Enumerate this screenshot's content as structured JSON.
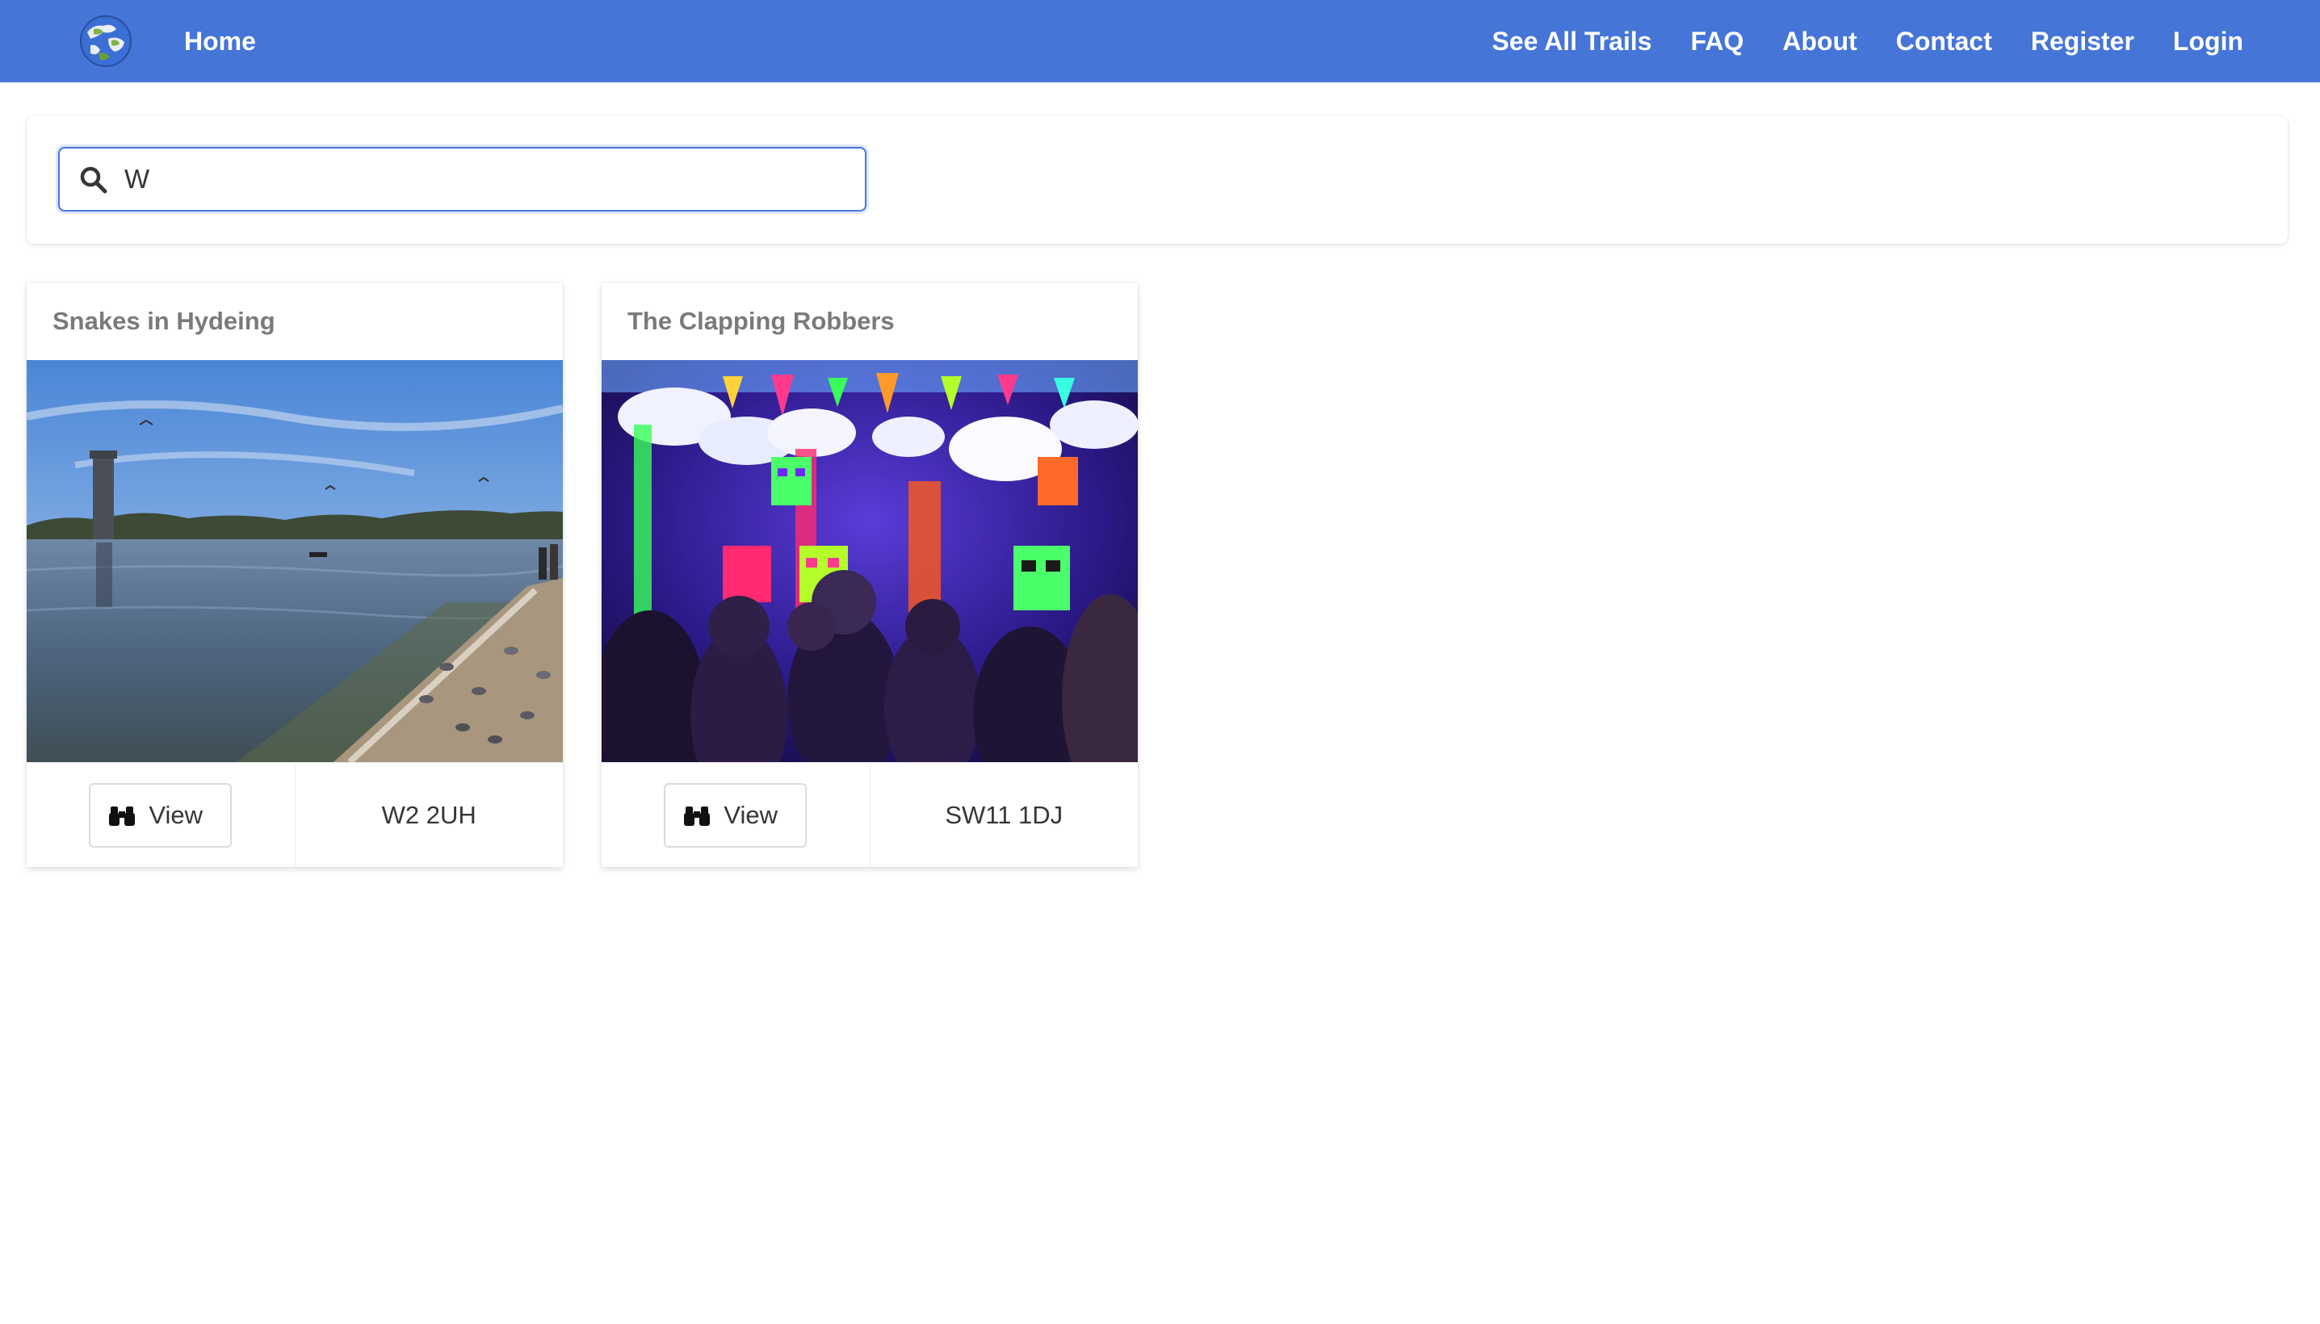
{
  "navbar": {
    "logo_icon": "globe-logo-icon",
    "home_label": "Home",
    "links": [
      {
        "label": "See All Trails"
      },
      {
        "label": "FAQ"
      },
      {
        "label": "About"
      },
      {
        "label": "Contact"
      },
      {
        "label": "Register"
      },
      {
        "label": "Login"
      }
    ],
    "background_color": "#4575d7"
  },
  "search": {
    "icon": "search-icon",
    "value": "W",
    "placeholder": ""
  },
  "trails": [
    {
      "title": "Snakes in Hydeing",
      "image": "lake-photo",
      "view_label": "View",
      "view_icon": "binoculars-icon",
      "postcode": "W2 2UH"
    },
    {
      "title": "The Clapping Robbers",
      "image": "neon-party-photo",
      "view_label": "View",
      "view_icon": "binoculars-icon",
      "postcode": "SW11 1DJ"
    }
  ]
}
